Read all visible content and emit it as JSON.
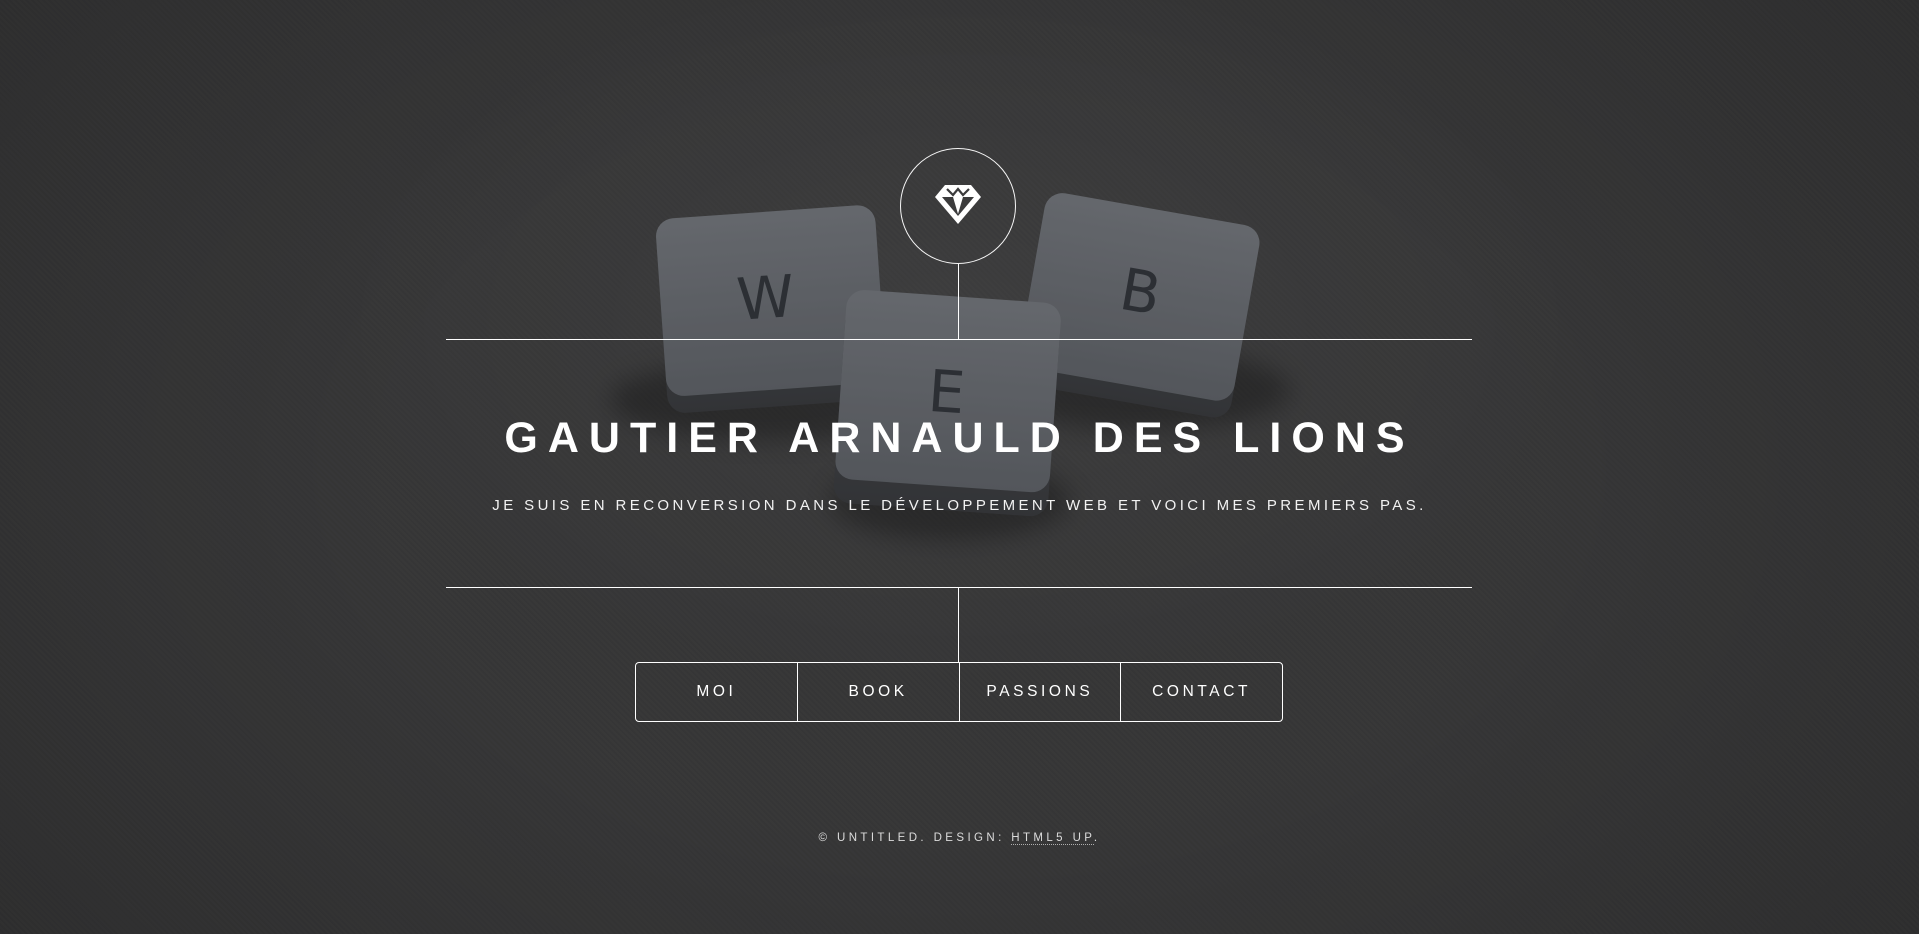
{
  "header": {
    "title": "GAUTIER ARNAULD DES LIONS",
    "subtitle": "JE SUIS EN RECONVERSION DANS LE DÉVELOPPEMENT WEB ET VOICI MES PREMIERS PAS.",
    "logo_icon": "diamond-icon"
  },
  "background": {
    "tiles": [
      "W",
      "E",
      "B"
    ]
  },
  "nav": {
    "items": [
      {
        "label": "MOI"
      },
      {
        "label": "BOOK"
      },
      {
        "label": "PASSIONS"
      },
      {
        "label": "CONTACT"
      }
    ]
  },
  "footer": {
    "copyright": "© UNTITLED. DESIGN: ",
    "credit_link": "HTML5 UP",
    "end": "."
  }
}
